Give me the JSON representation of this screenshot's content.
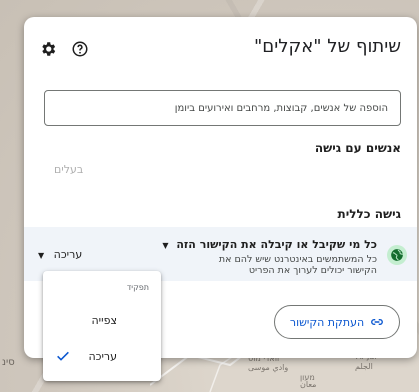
{
  "map": {
    "labels": [
      "Al-Jal",
      "الجلم",
      "וואדי מוס",
      "وادي موسى",
      "מעון",
      "معان",
      "סינ"
    ]
  },
  "dialog": {
    "title": "שיתוף של \"אקלים\"",
    "icons": {
      "settings": "gear-icon",
      "help": "help-icon"
    },
    "add_people_placeholder": "הוספה של אנשים, קבוצות, מרחבים ואירועים ביומן",
    "people_with_access_title": "אנשים עם גישה",
    "owner_label": "בעלים",
    "general_access_title": "גישה כללית",
    "general_access": {
      "option": "כל מי שקיבל או קיבלה את הקישור הזה",
      "description": "כל המשתמשים באינטרנט שיש להם את הקישור יכולים לערוך את הפריט",
      "role": "עריכה",
      "icon": "globe-icon",
      "accent": "#c4eed0"
    },
    "copy_link_label": "העתקת הקישור",
    "copy_link_color": "#0b57d0"
  },
  "role_menu": {
    "header": "תפקיד",
    "items": [
      {
        "label": "צפייה",
        "selected": false
      },
      {
        "label": "עריכה",
        "selected": true
      }
    ]
  }
}
